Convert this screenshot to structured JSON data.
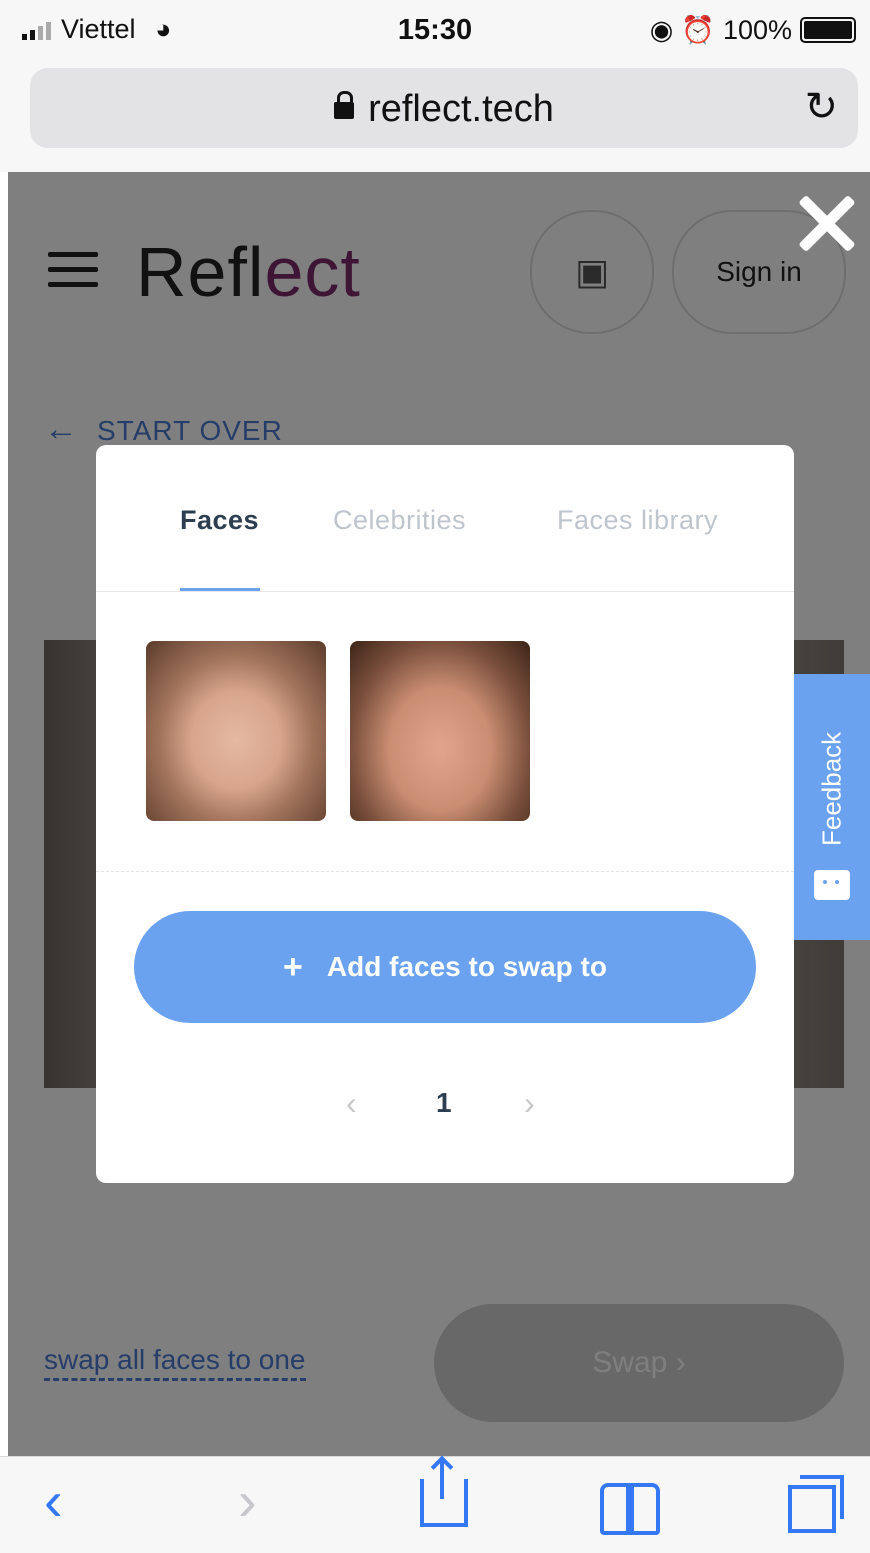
{
  "status_bar": {
    "carrier": "Viettel",
    "time": "15:30",
    "battery": "100%"
  },
  "browser": {
    "url": "reflect.tech"
  },
  "site_header": {
    "logo_text_start": "Refl",
    "logo_text_end": "ect",
    "sign_in_label": "Sign in"
  },
  "page": {
    "start_over_label": "START OVER",
    "swap_all_label": "swap all faces to one",
    "swap_button_label": "Swap"
  },
  "modal": {
    "tabs": [
      {
        "label": "Faces",
        "active": true
      },
      {
        "label": "Celebrities",
        "active": false
      },
      {
        "label": "Faces library",
        "active": false
      }
    ],
    "add_faces_label": "Add faces to swap to",
    "current_page": "1"
  },
  "feedback": {
    "label": "Feedback"
  },
  "colors": {
    "accent": "#6aa2f0",
    "link": "#4a7bd1",
    "ios_blue": "#3478f6"
  },
  "icons": [
    "lock-icon",
    "reload-icon",
    "hamburger-icon",
    "gift-icon",
    "close-icon",
    "arrow-left-icon",
    "plus-icon",
    "chevron-left-icon",
    "chevron-right-icon",
    "share-icon",
    "bookmarks-icon",
    "tabs-icon"
  ]
}
